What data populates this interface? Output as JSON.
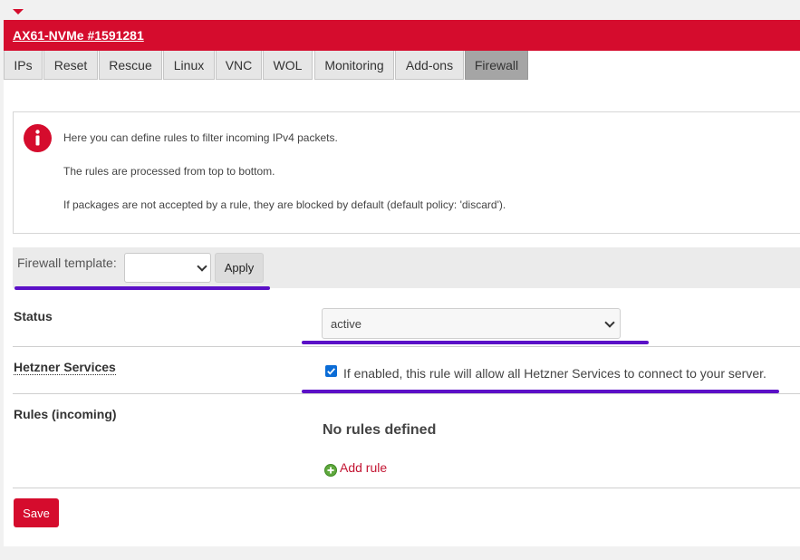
{
  "header": {
    "title": "AX61-NVMe #1591281"
  },
  "tabs": [
    {
      "label": "IPs"
    },
    {
      "label": "Reset"
    },
    {
      "label": "Rescue"
    },
    {
      "label": "Linux"
    },
    {
      "label": "VNC"
    },
    {
      "label": "WOL"
    },
    {
      "label": "Monitoring"
    },
    {
      "label": "Add-ons"
    },
    {
      "label": "Firewall",
      "active": true
    }
  ],
  "info": {
    "icon": "info-icon",
    "lines": [
      "Here you can define rules to filter incoming IPv4 packets.",
      "The rules are processed from top to bottom.",
      "If packages are not accepted by a rule, they are blocked by default (default policy: 'discard')."
    ]
  },
  "template": {
    "label": "Firewall template:",
    "selected": "",
    "apply_label": "Apply"
  },
  "status": {
    "label": "Status",
    "value": "active"
  },
  "hetzner_services": {
    "label": "Hetzner Services",
    "checked": true,
    "text": "If enabled, this rule will allow all Hetzner Services to connect to your server."
  },
  "rules": {
    "label": "Rules (incoming)",
    "empty_text": "No rules defined",
    "add_label": "Add rule"
  },
  "save_label": "Save",
  "colors": {
    "brand": "#d50c2d",
    "highlight": "#5b10c7",
    "checkbox": "#0b6cd6",
    "add_icon": "#5fa83d"
  }
}
